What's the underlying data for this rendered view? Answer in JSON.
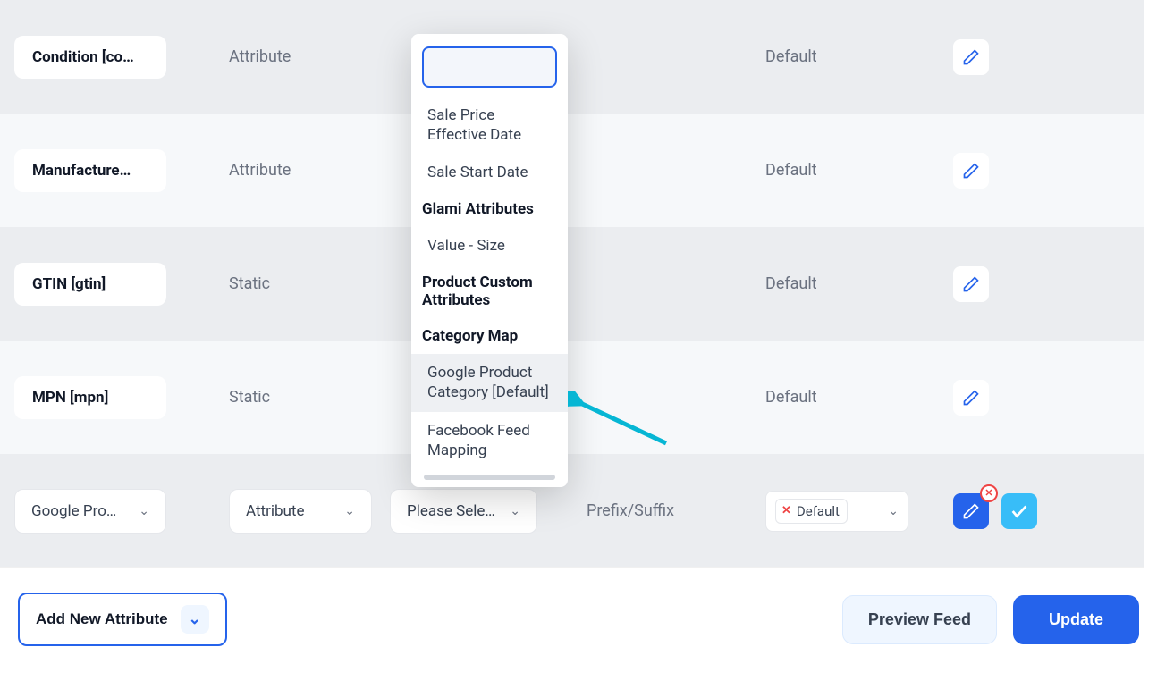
{
  "rows": [
    {
      "label": "Condition [co…",
      "type": "Attribute",
      "output": "Default"
    },
    {
      "label": "Manufacture…",
      "type": "Attribute",
      "output": "Default"
    },
    {
      "label": "GTIN [gtin]",
      "type": "Static",
      "output": "Default"
    },
    {
      "label": "MPN [mpn]",
      "type": "Static",
      "output": "Default"
    }
  ],
  "editRow": {
    "attrSelect": "Google Pro…",
    "typeSelect": "Attribute",
    "valueSelect": "Please Sele…",
    "prefixLabel": "Prefix/Suffix",
    "outputTag": "Default"
  },
  "dropdown": {
    "items": [
      {
        "text": "Sale Price Effective Date",
        "group": false
      },
      {
        "text": "Sale Start Date",
        "group": false
      },
      {
        "text": "Glami Attributes",
        "group": true
      },
      {
        "text": "Value - Size",
        "group": false
      },
      {
        "text": "Product Custom Attributes",
        "group": true
      },
      {
        "text": "Category Map",
        "group": true
      },
      {
        "text": "Google Product Category [Default]",
        "group": false,
        "highlight": true
      },
      {
        "text": "Facebook Feed Mapping",
        "group": false
      }
    ]
  },
  "footer": {
    "addNew": "Add New Attribute",
    "preview": "Preview Feed",
    "update": "Update"
  }
}
